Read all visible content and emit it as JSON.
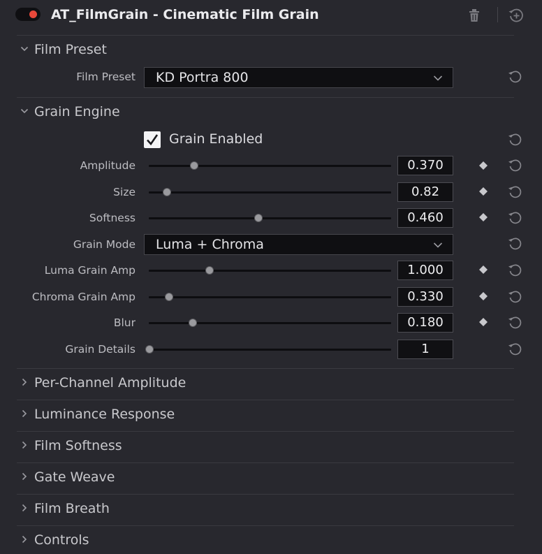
{
  "header": {
    "title": "AT_FilmGrain - Cinematic Film Grain",
    "enabled": true,
    "toggle_color": "#e8483a",
    "icons": [
      "trash-icon",
      "add-version-icon"
    ]
  },
  "sections": {
    "film_preset": {
      "label": "Film Preset",
      "expanded": true
    },
    "grain_engine": {
      "label": "Grain Engine",
      "expanded": true
    },
    "collapsed": [
      {
        "label": "Per-Channel Amplitude"
      },
      {
        "label": "Luminance Response"
      },
      {
        "label": "Film Softness"
      },
      {
        "label": "Gate Weave"
      },
      {
        "label": "Film Breath"
      },
      {
        "label": "Controls"
      }
    ]
  },
  "film_preset": {
    "label": "Film Preset",
    "value": "KD Portra 800"
  },
  "grain_enabled": {
    "label": "Grain Enabled",
    "checked": true
  },
  "params": [
    {
      "label": "Amplitude",
      "value": "0.370",
      "slider_fraction": 0.185,
      "keyframe": true
    },
    {
      "label": "Size",
      "value": "0.82",
      "slider_fraction": 0.072,
      "keyframe": true
    },
    {
      "label": "Softness",
      "value": "0.460",
      "slider_fraction": 0.452,
      "keyframe": true
    }
  ],
  "grain_mode": {
    "label": "Grain Mode",
    "value": "Luma + Chroma"
  },
  "params2": [
    {
      "label": "Luma Grain Amp",
      "value": "1.000",
      "slider_fraction": 0.248,
      "keyframe": true
    },
    {
      "label": "Chroma Grain Amp",
      "value": "0.330",
      "slider_fraction": 0.081,
      "keyframe": true
    },
    {
      "label": "Blur",
      "value": "0.180",
      "slider_fraction": 0.18,
      "keyframe": true
    },
    {
      "label": "Grain Details",
      "value": "1",
      "slider_fraction": 0.0,
      "keyframe": false
    }
  ]
}
